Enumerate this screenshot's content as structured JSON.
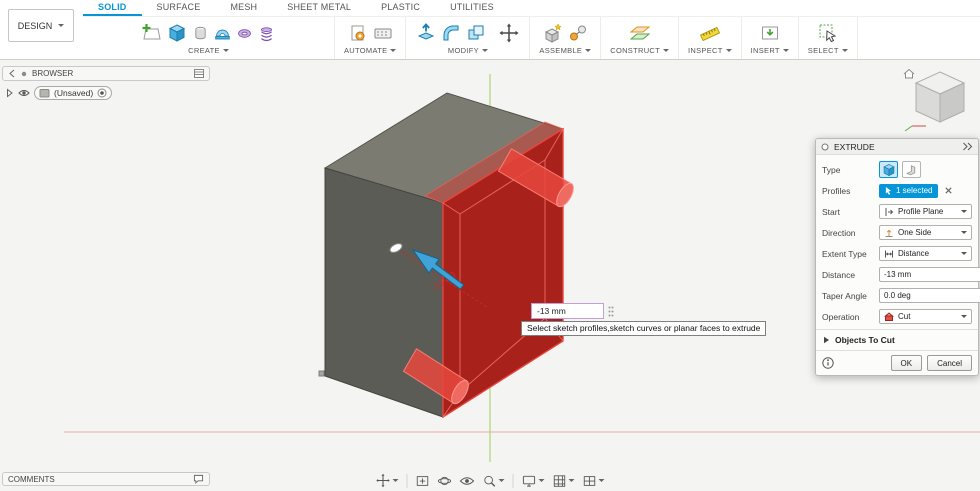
{
  "accent_colors": {
    "fusion_blue": "#0696d7",
    "preview_red": "#b3271f"
  },
  "tabs_bar": {
    "design_label": "DESIGN",
    "tabs": [
      {
        "label": "SOLID",
        "active": true
      },
      {
        "label": "SURFACE",
        "active": false
      },
      {
        "label": "MESH",
        "active": false
      },
      {
        "label": "SHEET METAL",
        "active": false
      },
      {
        "label": "PLASTIC",
        "active": false
      },
      {
        "label": "UTILITIES",
        "active": false
      }
    ]
  },
  "toolbar": {
    "groups": [
      {
        "label": "CREATE"
      },
      {
        "label": "AUTOMATE"
      },
      {
        "label": "MODIFY"
      },
      {
        "label": "ASSEMBLE"
      },
      {
        "label": "CONSTRUCT"
      },
      {
        "label": "INSPECT"
      },
      {
        "label": "INSERT"
      },
      {
        "label": "SELECT"
      }
    ]
  },
  "browser_panel": {
    "title": "BROWSER",
    "document": "(Unsaved)"
  },
  "comments_panel": {
    "title": "COMMENTS"
  },
  "canvas": {
    "dimension_annotation": "-13.00",
    "dimension_input_value": "-13 mm",
    "tooltip": "Select sketch profiles,sketch curves or planar faces to extrude"
  },
  "extrude_dialog": {
    "title": "EXTRUDE",
    "type_label": "Type",
    "profiles_label": "Profiles",
    "profiles_value": "1 selected",
    "start_label": "Start",
    "start_value": "Profile Plane",
    "direction_label": "Direction",
    "direction_value": "One Side",
    "extent_type_label": "Extent Type",
    "extent_type_value": "Distance",
    "distance_label": "Distance",
    "distance_value": "-13 mm",
    "taper_angle_label": "Taper Angle",
    "taper_angle_value": "0.0 deg",
    "operation_label": "Operation",
    "operation_value": "Cut",
    "objects_to_cut_label": "Objects To Cut",
    "ok_label": "OK",
    "cancel_label": "Cancel"
  }
}
